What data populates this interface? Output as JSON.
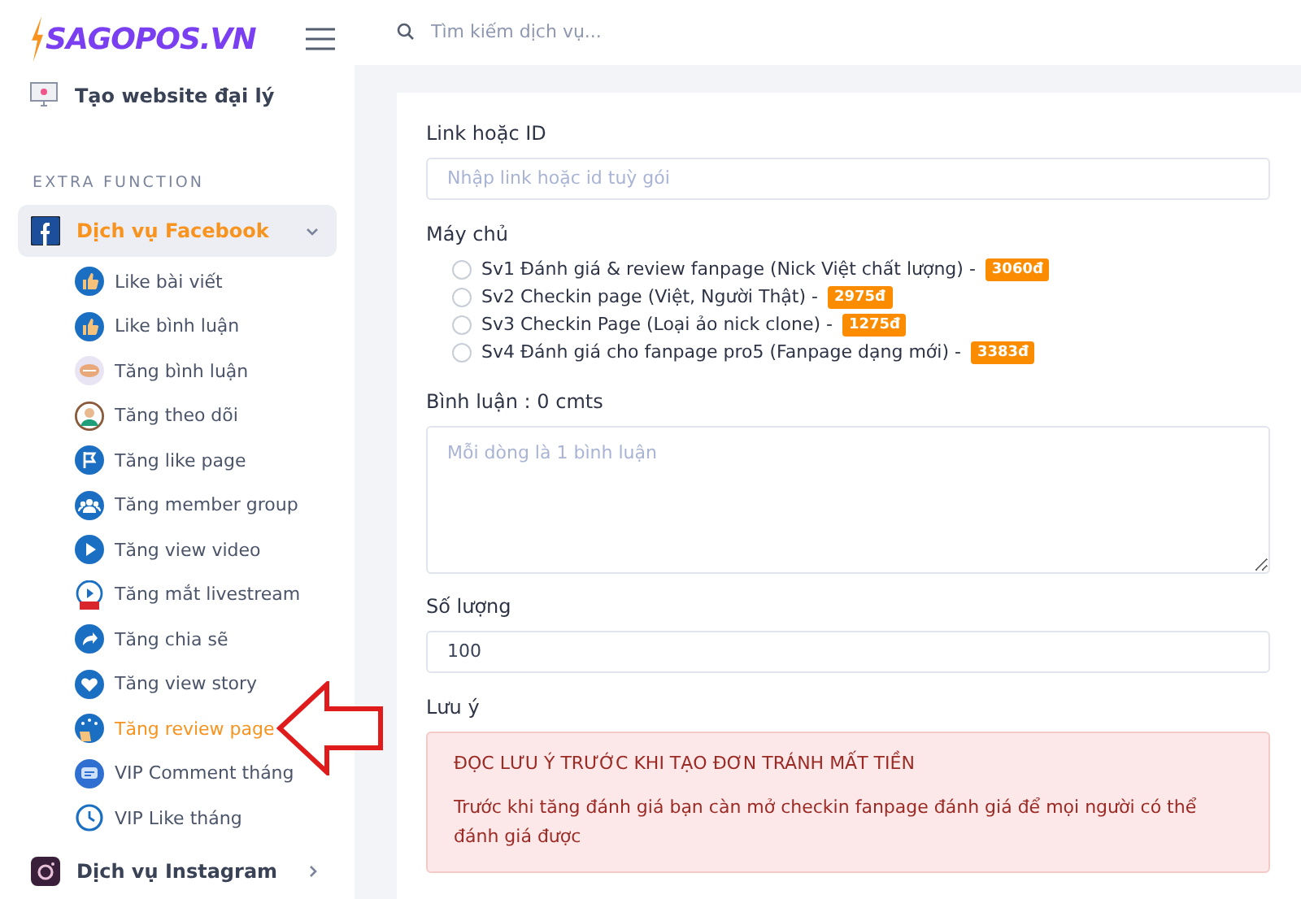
{
  "brand": {
    "logo": "SAGOPOS.VN"
  },
  "search": {
    "placeholder": "Tìm kiếm dịch vụ..."
  },
  "sidebar": {
    "top_item": {
      "label": "Tạo website đại lý"
    },
    "section_title": "EXTRA FUNCTION",
    "groups": [
      {
        "label": "Dịch vụ Facebook",
        "kind": "facebook",
        "expanded": true,
        "selected": true,
        "children": [
          {
            "label": "Like bài viết",
            "kind": "like",
            "selected": false
          },
          {
            "label": "Like bình luận",
            "kind": "like",
            "selected": false
          },
          {
            "label": "Tăng bình luận",
            "kind": "comment",
            "selected": false
          },
          {
            "label": "Tăng theo dõi",
            "kind": "person",
            "selected": false
          },
          {
            "label": "Tăng like page",
            "kind": "flag",
            "selected": false
          },
          {
            "label": "Tăng member group",
            "kind": "group",
            "selected": false
          },
          {
            "label": "Tăng view video",
            "kind": "play",
            "selected": false
          },
          {
            "label": "Tăng mắt livestream",
            "kind": "live",
            "selected": false
          },
          {
            "label": "Tăng chia sẽ",
            "kind": "share",
            "selected": false
          },
          {
            "label": "Tăng view story",
            "kind": "heart",
            "selected": false
          },
          {
            "label": "Tăng review page",
            "kind": "star",
            "selected": true
          },
          {
            "label": "VIP Comment tháng",
            "kind": "chat",
            "selected": false
          },
          {
            "label": "VIP Like tháng",
            "kind": "clock",
            "selected": false
          }
        ]
      },
      {
        "label": "Dịch vụ Instagram",
        "kind": "instagram",
        "expanded": false,
        "selected": false
      }
    ]
  },
  "form": {
    "link_field": {
      "label": "Link hoặc ID",
      "placeholder": "Nhập link hoặc id tuỳ gói"
    },
    "server": {
      "label": "Máy chủ",
      "options": [
        {
          "label": "Sv1 Đánh giá & review fanpage (Nick Việt chất lượng) -",
          "price": "3060đ",
          "selected": false
        },
        {
          "label": "Sv2 Checkin page (Việt, Người Thật) -",
          "price": "2975đ",
          "selected": false
        },
        {
          "label": "Sv3 Checkin Page (Loại ảo nick clone) -",
          "price": "1275đ",
          "selected": false
        },
        {
          "label": "Sv4 Đánh giá cho fanpage pro5 (Fanpage dạng mới) -",
          "price": "3383đ",
          "selected": false
        }
      ]
    },
    "comments": {
      "label": "Bình luận : 0 cmts",
      "placeholder": "Mỗi dòng là 1 bình luận"
    },
    "quantity": {
      "label": "Số lượng",
      "value": "100"
    },
    "note": {
      "label": "Lưu ý",
      "title": "ĐỌC LƯU Ý TRƯỚC KHI TẠO ĐƠN TRÁNH MẤT TIỀN",
      "paragraphs": [
        "Trước khi tăng đánh giá bạn càn mở checkin fanpage đánh giá để mọi người có thể đánh giá được"
      ]
    }
  }
}
